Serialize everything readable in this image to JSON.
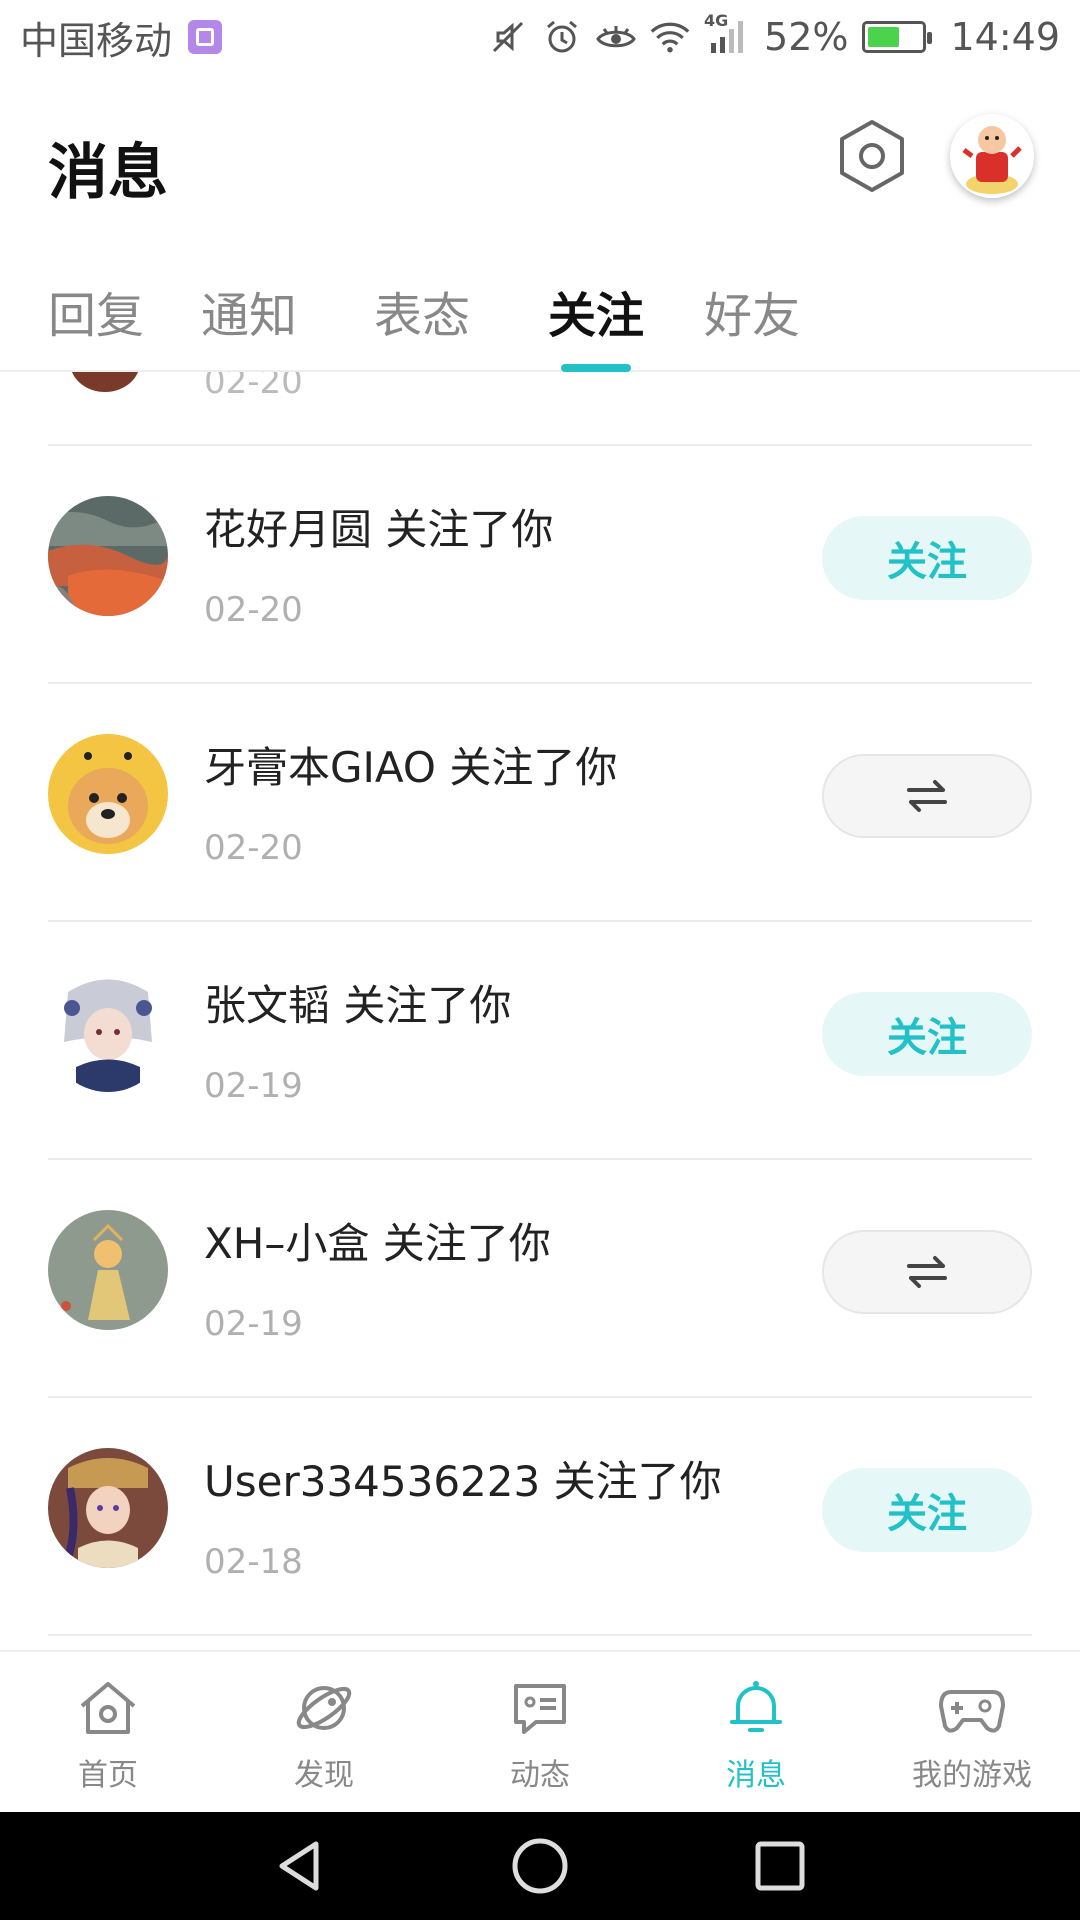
{
  "status_bar": {
    "carrier": "中国移动",
    "network_badge": "4G",
    "battery": "52%",
    "time": "14:49",
    "icons": [
      "gallery-icon",
      "mute-icon",
      "alarm-icon",
      "eye-icon",
      "wifi-icon",
      "signal-icon",
      "battery-icon"
    ]
  },
  "header": {
    "title": "消息",
    "settings_icon": "settings-icon"
  },
  "tabs": [
    {
      "label": "回复",
      "active": false
    },
    {
      "label": "通知",
      "active": false
    },
    {
      "label": "表态",
      "active": false
    },
    {
      "label": "关注",
      "active": true
    },
    {
      "label": "好友",
      "active": false
    }
  ],
  "partial_row": {
    "date": "02-20"
  },
  "rows": [
    {
      "text": "花好月圆 关注了你",
      "date": "02-20",
      "action": "follow",
      "action_label": "关注"
    },
    {
      "text": "牙膏本GIAO 关注了你",
      "date": "02-20",
      "action": "mutual",
      "action_label": ""
    },
    {
      "text": "张文韬 关注了你",
      "date": "02-19",
      "action": "follow",
      "action_label": "关注"
    },
    {
      "text": "XH–小盒 关注了你",
      "date": "02-19",
      "action": "mutual",
      "action_label": ""
    },
    {
      "text": "User334536223 关注了你",
      "date": "02-18",
      "action": "follow",
      "action_label": "关注"
    }
  ],
  "bottom_nav": [
    {
      "label": "首页",
      "icon": "home-icon",
      "active": false
    },
    {
      "label": "发现",
      "icon": "planet-icon",
      "active": false
    },
    {
      "label": "动态",
      "icon": "chat-icon",
      "active": false
    },
    {
      "label": "消息",
      "icon": "bell-icon",
      "active": true
    },
    {
      "label": "我的游戏",
      "icon": "gamepad-icon",
      "active": false
    }
  ],
  "colors": {
    "accent": "#21c1c7",
    "follow_bg": "#e6f7f8",
    "muted_text": "#b0b0b0"
  }
}
